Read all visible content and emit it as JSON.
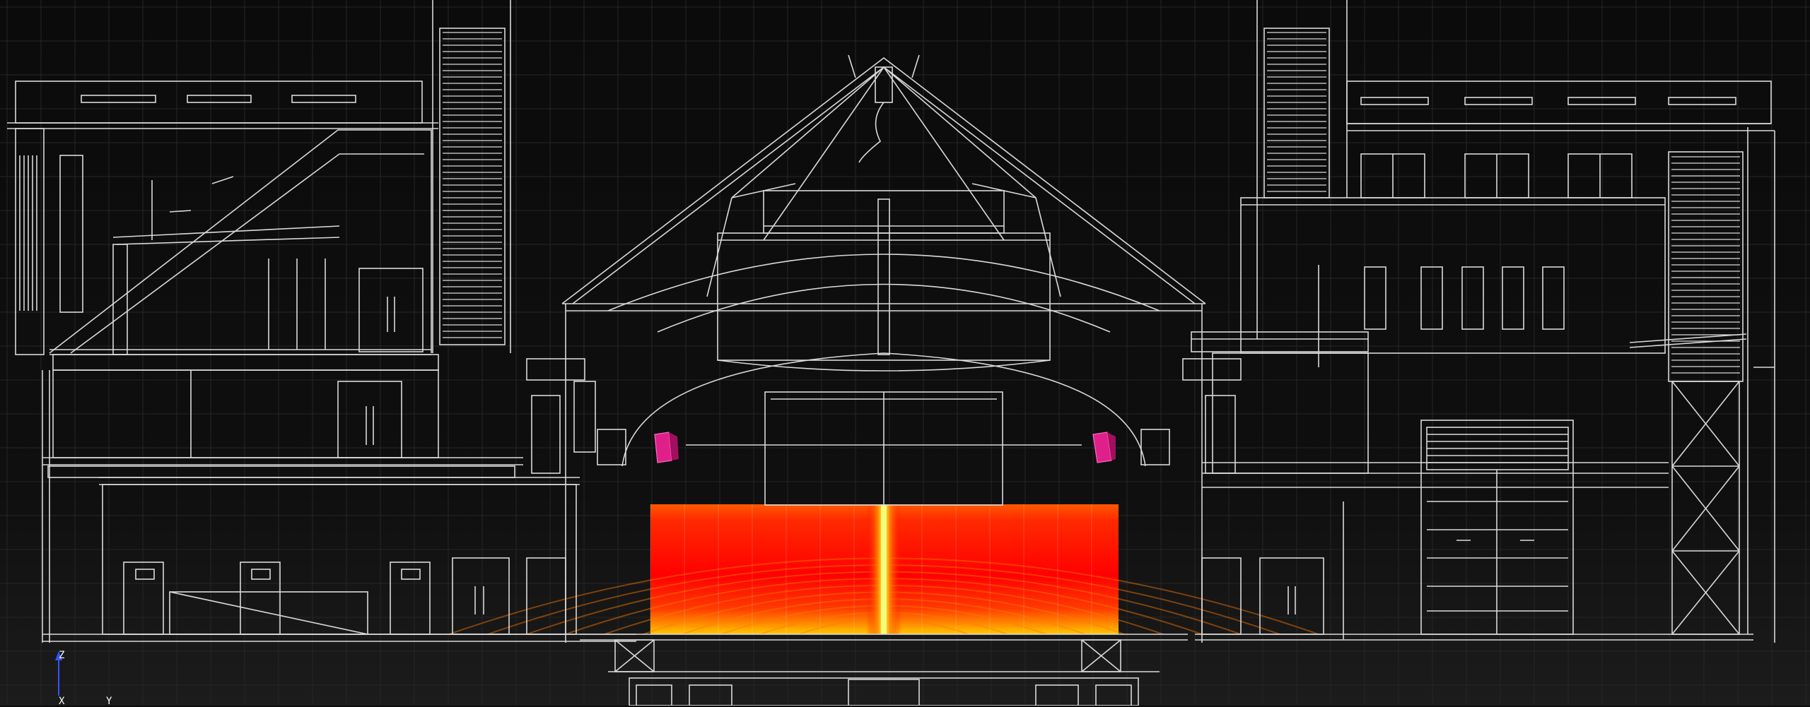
{
  "viewport": {
    "background": "#0b0b0b",
    "line_color": "#d9d9d9",
    "grid_color": "#262626",
    "speaker_color": "#e0208a",
    "heatmap_colors": [
      "#ff5a00",
      "#ff2a00",
      "#ff0000",
      "#ff8c00",
      "#ffc800",
      "#ffff40"
    ]
  },
  "axis_gizmo": {
    "z_label": "Z",
    "x_label": "X",
    "y_label": "Y",
    "z_color": "#3355ff"
  }
}
